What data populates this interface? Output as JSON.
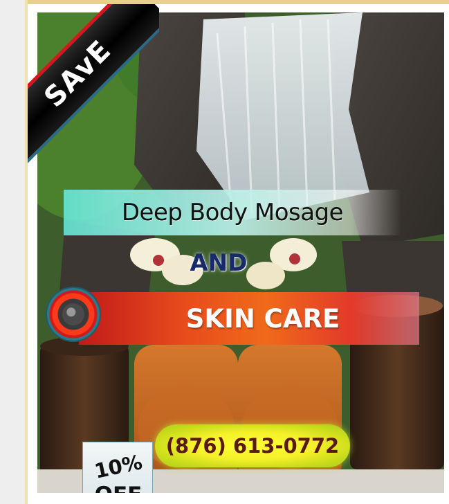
{
  "ad": {
    "ribbon_label": "SAvE",
    "headline": "Deep Body Mosage",
    "connector": "AND",
    "subheadline": "SKIN CARE",
    "phone": "(876) 613-0772",
    "discount_percent": "10%",
    "discount_off": "OFF"
  },
  "colors": {
    "ribbon_band": "#000000",
    "ribbon_edge": "#d8141c",
    "headline_banner": "#66e6d6",
    "connector_text": "#172a6c",
    "skin_banner": "#e74a1c",
    "phone_pill": "#f4f02a",
    "phone_text": "#5a1a12",
    "card_border": "#e8d28a"
  },
  "icons": [
    "waterfall-photo",
    "orchid-flowers",
    "rolled-towels",
    "candle",
    "ring-badge-icon"
  ]
}
